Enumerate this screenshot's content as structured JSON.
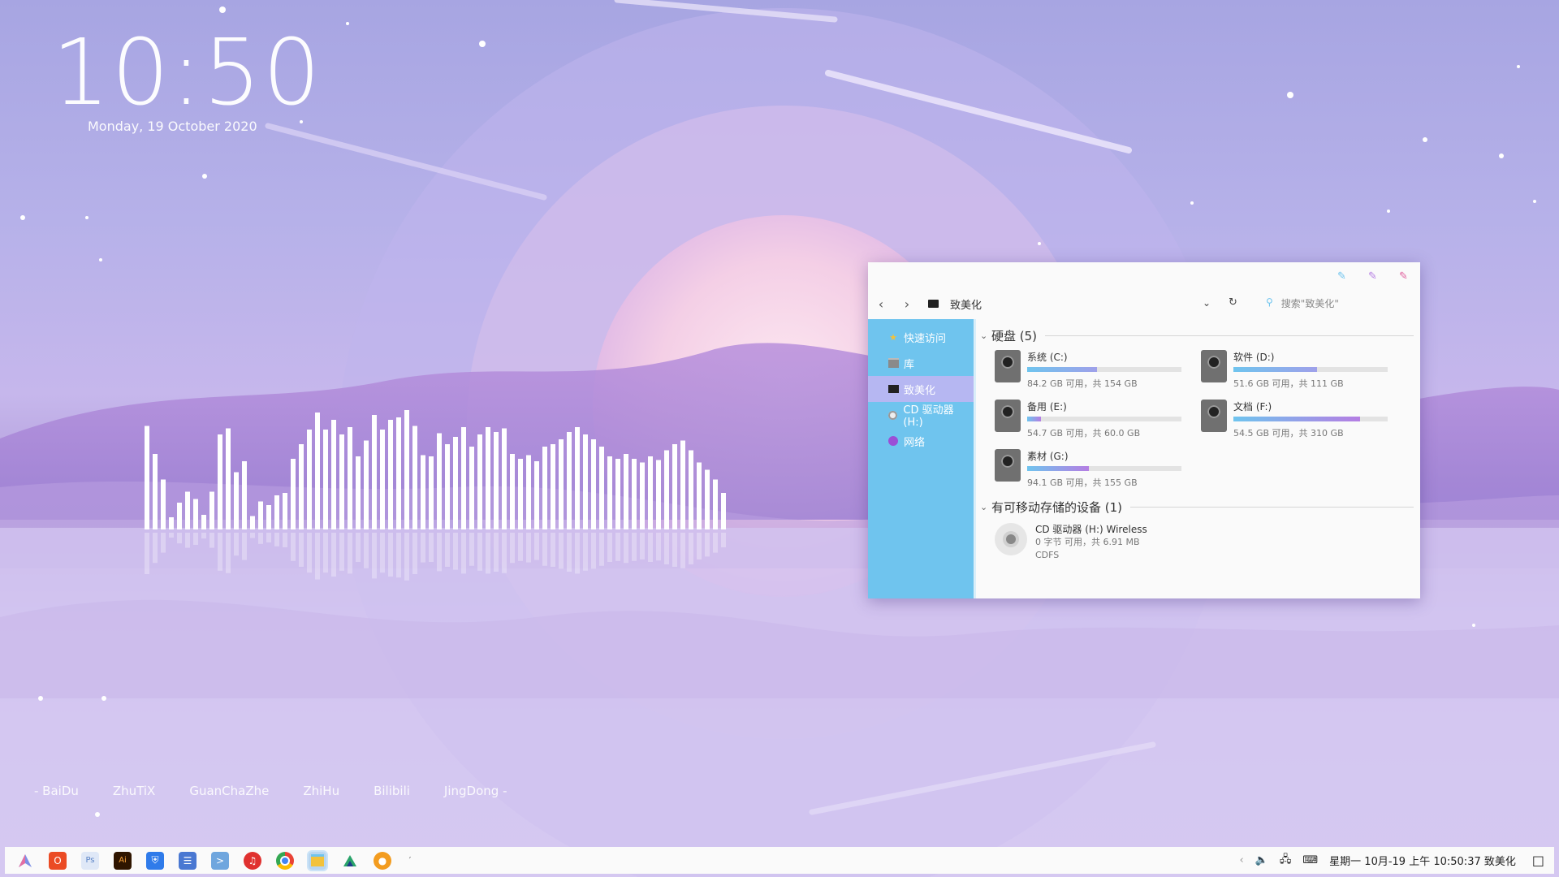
{
  "desktop": {
    "time": "10:50",
    "date": "Monday, 19 October 2020",
    "links": [
      "- BaiDu",
      "ZhuTiX",
      "GuanChaZhe",
      "ZhiHu",
      "Bilibili",
      "JingDong -"
    ]
  },
  "explorer": {
    "path": "致美化",
    "search_placeholder": "搜索\"致美化\"",
    "nav": [
      {
        "label": "快速访问",
        "icon": "star-icon"
      },
      {
        "label": "库",
        "icon": "library-icon"
      },
      {
        "label": "致美化",
        "icon": "pc-icon",
        "selected": true
      },
      {
        "label": "CD 驱动器 (H:)",
        "icon": "cd-icon"
      },
      {
        "label": "网络",
        "icon": "network-icon"
      }
    ],
    "group_drives": "硬盘 (5)",
    "drives": [
      {
        "name": "系统 (C:)",
        "size": "84.2 GB 可用，共 154 GB",
        "used_fraction": 0.45,
        "color": "#9fa0ea"
      },
      {
        "name": "软件 (D:)",
        "size": "51.6 GB 可用，共 111 GB",
        "used_fraction": 0.54,
        "color": "#9fa0ea"
      },
      {
        "name": "备用 (E:)",
        "size": "54.7 GB 可用，共 60.0 GB",
        "used_fraction": 0.09,
        "color": "#b57ee3"
      },
      {
        "name": "文档 (F:)",
        "size": "54.5 GB 可用，共 310 GB",
        "used_fraction": 0.82,
        "color": "#b57ee3"
      },
      {
        "name": "素材 (G:)",
        "size": "94.1 GB 可用，共 155 GB",
        "used_fraction": 0.4,
        "color": "#b57ee3"
      }
    ],
    "group_removable": "有可移动存储的设备 (1)",
    "cd": {
      "name": "CD 驱动器 (H:) Wireless",
      "size": "0 字节 可用，共 6.91 MB",
      "fs": "CDFS"
    }
  },
  "taskbar": {
    "icons": [
      "launcher-icon",
      "office-icon",
      "photoshop-icon",
      "illustrator-icon",
      "shield-icon",
      "notepad-icon",
      "terminal-icon",
      "netease-music-icon",
      "chrome-icon",
      "file-explorer-icon",
      "app-green-icon",
      "app-orange-icon"
    ],
    "clock": "星期一 10月-19 上午 10:50:37 致美化"
  },
  "visualizer": {
    "levels": [
      0.85,
      0.62,
      0.41,
      0.1,
      0.22,
      0.31,
      0.25,
      0.12,
      0.31,
      0.78,
      0.83,
      0.47,
      0.56,
      0.11,
      0.23,
      0.2,
      0.28,
      0.3,
      0.58,
      0.7,
      0.82,
      0.96,
      0.82,
      0.9,
      0.78,
      0.84,
      0.6,
      0.73,
      0.94,
      0.82,
      0.9,
      0.92,
      0.98,
      0.85,
      0.61,
      0.6,
      0.79,
      0.7,
      0.76,
      0.84,
      0.68,
      0.78,
      0.84,
      0.8,
      0.83,
      0.62,
      0.58,
      0.61,
      0.56,
      0.68,
      0.7,
      0.74,
      0.8,
      0.84,
      0.78,
      0.74,
      0.68,
      0.6,
      0.58,
      0.62,
      0.58,
      0.55,
      0.6,
      0.57,
      0.65,
      0.7,
      0.73,
      0.65,
      0.55,
      0.49,
      0.41,
      0.3
    ]
  }
}
